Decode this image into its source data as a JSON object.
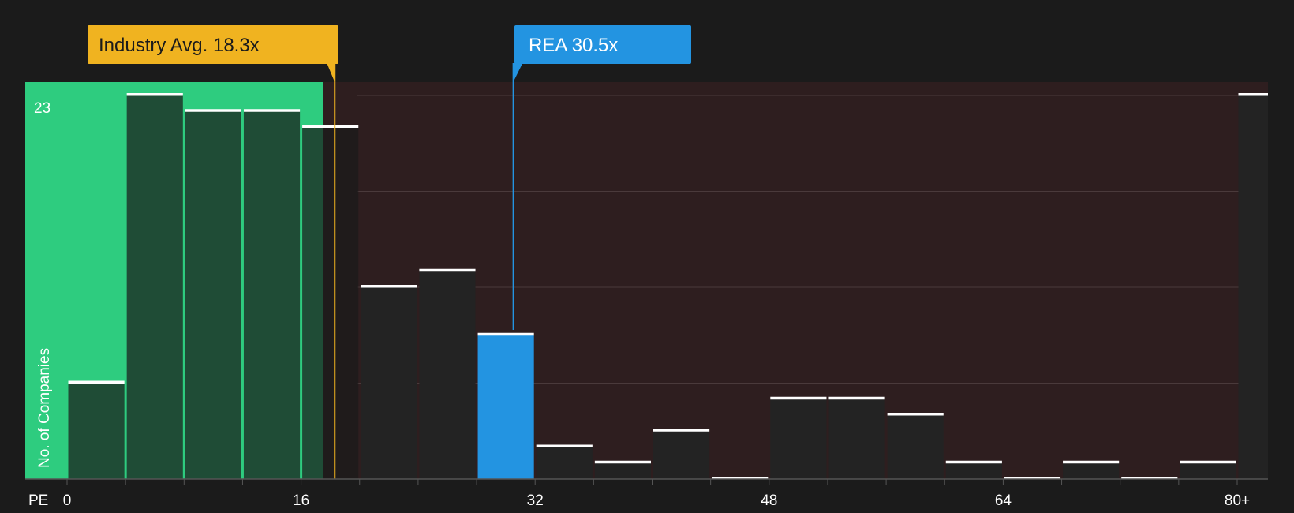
{
  "chart_data": {
    "type": "bar",
    "title": "",
    "xlabel": "PE",
    "ylabel": "No. of Companies",
    "x_ticks": [
      "0",
      "16",
      "32",
      "48",
      "64",
      "80+"
    ],
    "y_ticks": [
      "23"
    ],
    "ylim": [
      0,
      24
    ],
    "xlim": [
      -2.9,
      82
    ],
    "bins": [
      {
        "start": 0,
        "end": 4,
        "count": 6
      },
      {
        "start": 4,
        "end": 8,
        "count": 24
      },
      {
        "start": 8,
        "end": 12,
        "count": 23
      },
      {
        "start": 12,
        "end": 16,
        "count": 23
      },
      {
        "start": 16,
        "end": 20,
        "count": 22
      },
      {
        "start": 20,
        "end": 24,
        "count": 12
      },
      {
        "start": 24,
        "end": 28,
        "count": 13
      },
      {
        "start": 28,
        "end": 32,
        "count": 9
      },
      {
        "start": 32,
        "end": 36,
        "count": 2
      },
      {
        "start": 36,
        "end": 40,
        "count": 1
      },
      {
        "start": 40,
        "end": 44,
        "count": 3
      },
      {
        "start": 44,
        "end": 48,
        "count": 0
      },
      {
        "start": 48,
        "end": 52,
        "count": 5
      },
      {
        "start": 52,
        "end": 56,
        "count": 5
      },
      {
        "start": 56,
        "end": 60,
        "count": 4
      },
      {
        "start": 60,
        "end": 64,
        "count": 1
      },
      {
        "start": 64,
        "end": 68,
        "count": 0
      },
      {
        "start": 68,
        "end": 72,
        "count": 1
      },
      {
        "start": 72,
        "end": 76,
        "count": 0
      },
      {
        "start": 76,
        "end": 80,
        "count": 1
      },
      {
        "start": 80,
        "end": 82,
        "count": 24
      }
    ],
    "industry_avg": {
      "label": "Industry Avg. 18.3x",
      "value": 18.3
    },
    "company": {
      "label": "REA 30.5x",
      "value": 30.5
    },
    "colors": {
      "background": "#1b1b1b",
      "below_avg_zone": "#2ecc7f",
      "above_avg_zone": "#2e1e1f",
      "bar": "#232323",
      "bar_in_green": "#224a39",
      "highlight_bar": "#2394e1",
      "avg_callout": "#f0b320",
      "company_callout": "#2394e1",
      "bar_cap": "#ffffff"
    }
  }
}
